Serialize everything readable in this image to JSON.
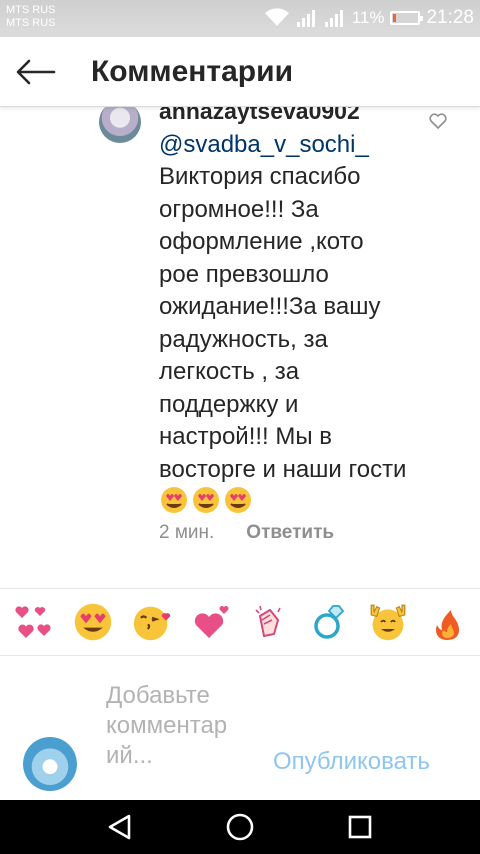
{
  "status_bar": {
    "carrier_1": "MTS RUS",
    "carrier_2": "MTS RUS",
    "battery_percent": "11%",
    "battery_level": 0.11,
    "time": "21:28",
    "icons": [
      "wifi-icon",
      "signal-icon",
      "signal-icon",
      "battery-icon"
    ]
  },
  "header": {
    "title": "Комментарии",
    "back_icon": "arrow-left-icon"
  },
  "comment": {
    "username": "annazaytseva0902",
    "mention": "@svadba_v_sochi_",
    "text": "Виктория спасибо огромное!!! За оформление ,кото рое превзошло ожидание!!!За вашу радужность, за легкость , за поддержку и настрой!!! Мы в восторге  и наши гости",
    "inline_emojis": [
      "heart-eyes-emoji",
      "heart-eyes-emoji",
      "heart-eyes-emoji"
    ],
    "time_ago": "2 мин.",
    "reply_label": "Ответить",
    "like_icon": "heart-outline-icon"
  },
  "reactions": [
    "two-hearts-emoji",
    "heart-eyes-emoji",
    "kissing-heart-emoji",
    "heart-emoji",
    "clapping-hands-emoji",
    "ring-emoji",
    "raised-hands-emoji",
    "fire-emoji"
  ],
  "composer": {
    "placeholder": "Добавьте комментар ий...",
    "publish_label": "Опубликовать"
  },
  "nav_bar": {
    "icons": [
      "back-triangle-icon",
      "home-circle-icon",
      "recents-square-icon"
    ]
  },
  "colors": {
    "mention": "#003569",
    "publish_disabled": "#8fc6ef",
    "placeholder": "#b3b3b3",
    "meta": "#8e8e8e"
  }
}
